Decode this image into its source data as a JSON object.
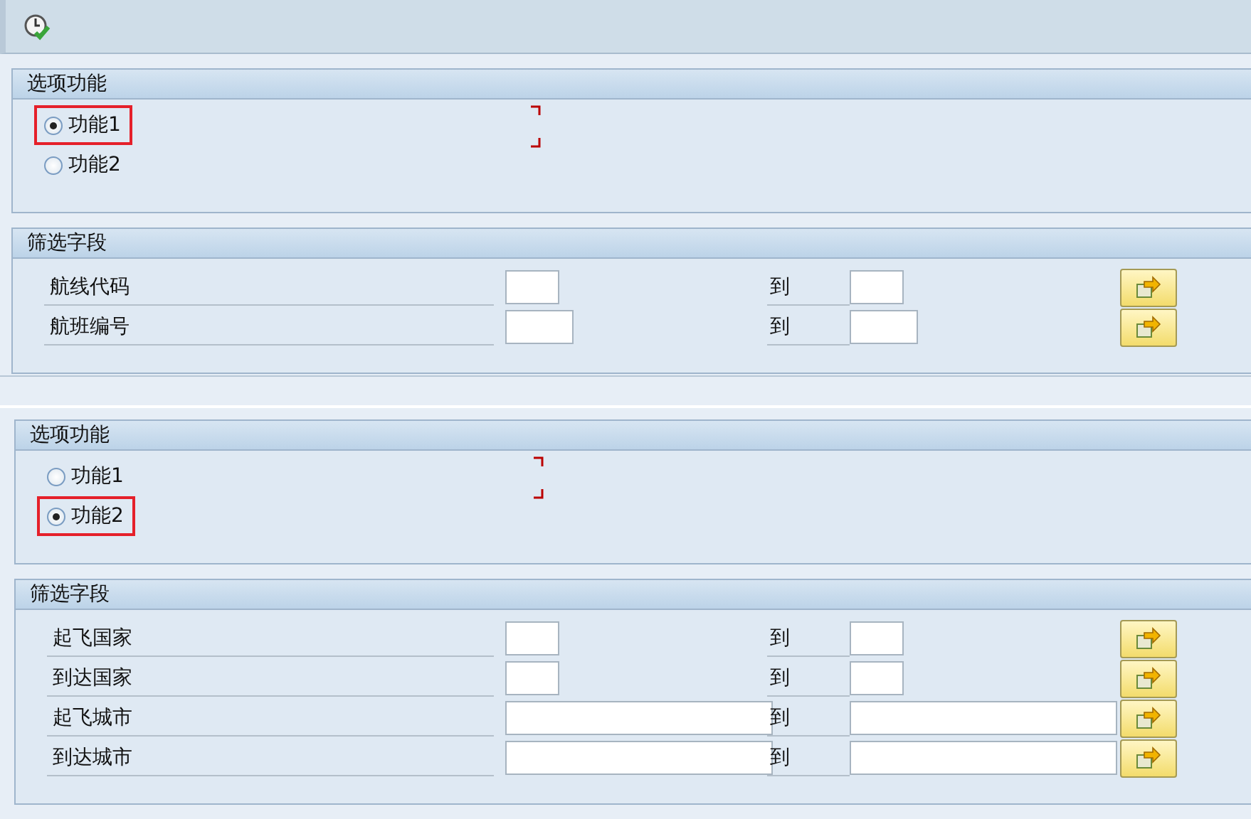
{
  "screens": [
    {
      "options": {
        "title": "选项功能",
        "items": [
          {
            "label": "功能1",
            "selected": true,
            "highlighted": true
          },
          {
            "label": "功能2",
            "selected": false,
            "highlighted": false
          }
        ]
      },
      "filter": {
        "title": "筛选字段",
        "rows": [
          {
            "label": "航线代码",
            "to": "到",
            "kind": "short"
          },
          {
            "label": "航班编号",
            "to": "到",
            "kind": "medium"
          }
        ]
      }
    },
    {
      "options": {
        "title": "选项功能",
        "items": [
          {
            "label": "功能1",
            "selected": false,
            "highlighted": false
          },
          {
            "label": "功能2",
            "selected": true,
            "highlighted": true
          }
        ]
      },
      "filter": {
        "title": "筛选字段",
        "rows": [
          {
            "label": "起飞国家",
            "to": "到",
            "kind": "short"
          },
          {
            "label": "到达国家",
            "to": "到",
            "kind": "short"
          },
          {
            "label": "起飞城市",
            "to": "到",
            "kind": "long"
          },
          {
            "label": "到达城市",
            "to": "到",
            "kind": "long"
          }
        ]
      }
    }
  ]
}
